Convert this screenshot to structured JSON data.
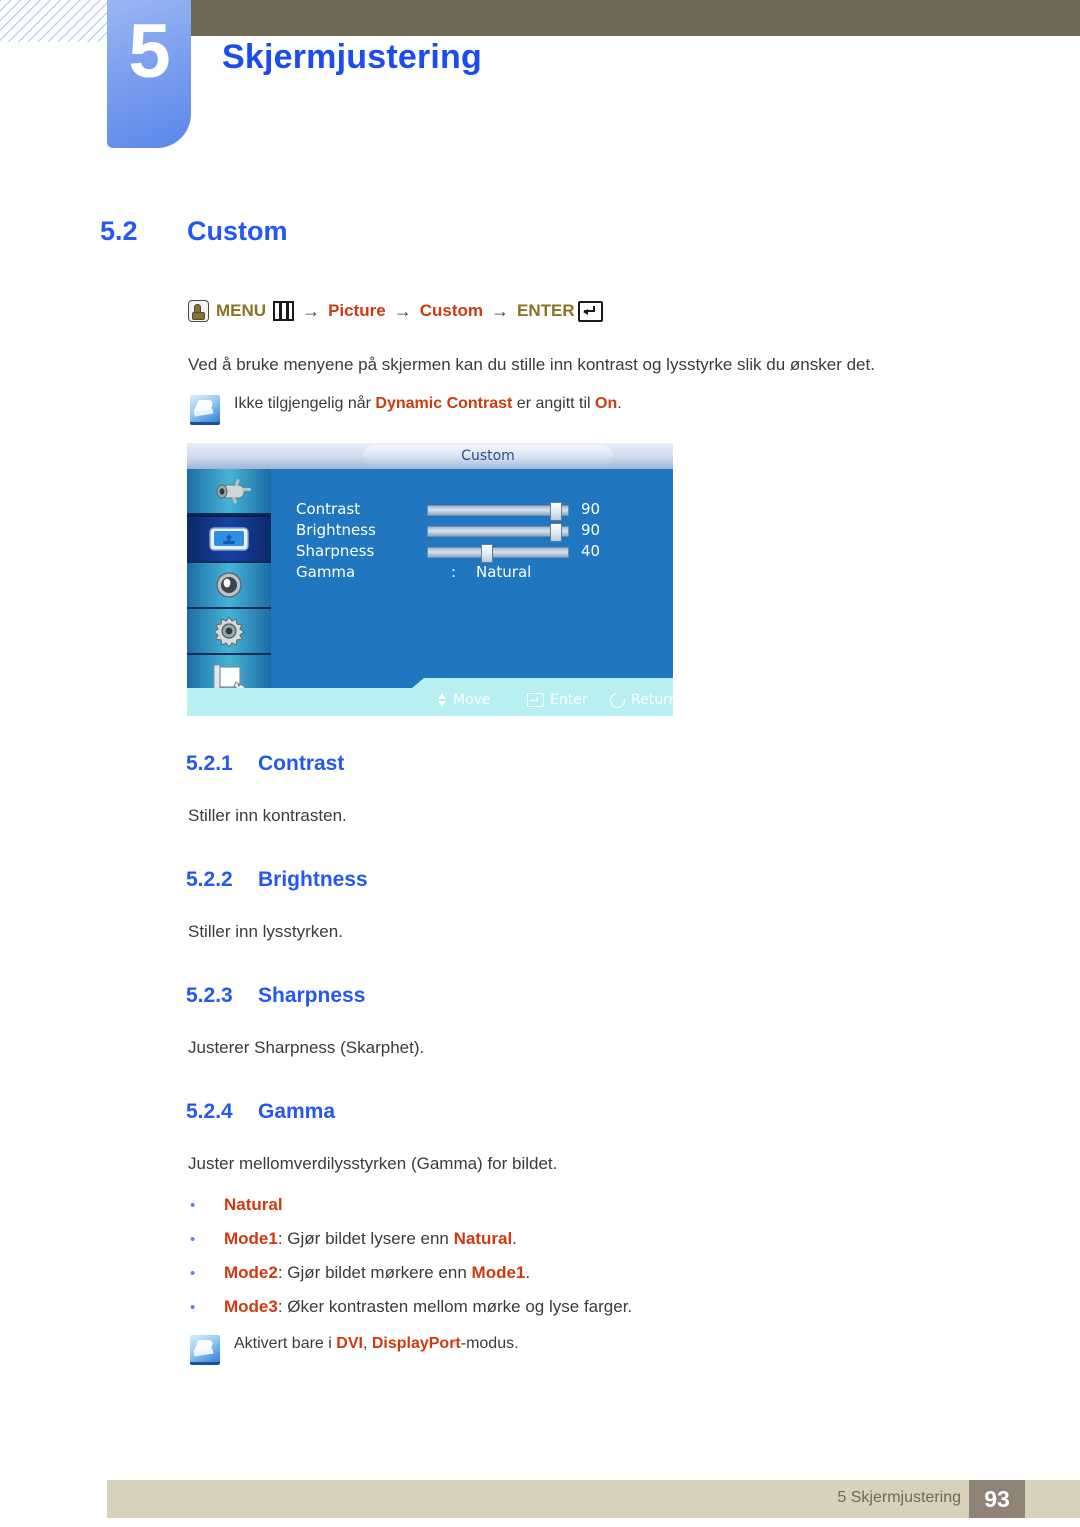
{
  "chapter": {
    "number": "5",
    "title": "Skjermjustering"
  },
  "section": {
    "number": "5.2",
    "title": "Custom"
  },
  "menu_path": {
    "hand_icon": "hand-press-icon",
    "menu_label": "MENU",
    "menu_bars_icon": "menu-bars-icon",
    "arrow1": "→",
    "item1": "Picture",
    "arrow2": "→",
    "item2": "Custom",
    "arrow3": "→",
    "enter_label": "ENTER",
    "enter_icon": "enter-key-icon"
  },
  "intro_text": "Ved å bruke menyene på skjermen kan du stille inn kontrast og lysstyrke slik du ønsker det.",
  "notes": [
    {
      "icon": "note-pencil-icon",
      "pre": "Ikke tilgjengelig når ",
      "em1": "Dynamic Contrast",
      "mid": " er angitt til ",
      "em2": "On",
      "post": "."
    },
    {
      "icon": "note-pencil-icon",
      "pre": "Aktivert bare i ",
      "em1": "DVI",
      "mid": ", ",
      "em2": "DisplayPort",
      "post": "-modus."
    }
  ],
  "osd": {
    "title": "Custom",
    "sidebar_icons": [
      "input-source-icon",
      "picture-icon",
      "sound-icon",
      "setup-gear-icon",
      "information-icon"
    ],
    "selected_sidebar_index": 1,
    "rows": [
      {
        "label": "Contrast",
        "value": "90",
        "percent": 90,
        "type": "slider"
      },
      {
        "label": "Brightness",
        "value": "90",
        "percent": 90,
        "type": "slider"
      },
      {
        "label": "Sharpness",
        "value": "40",
        "percent": 40,
        "type": "slider"
      },
      {
        "label": "Gamma",
        "value": "Natural",
        "separator": ":",
        "type": "option"
      }
    ],
    "hints": [
      {
        "icon": "move-updown-icon",
        "label": "Move"
      },
      {
        "icon": "enter-key-icon",
        "label": "Enter"
      },
      {
        "icon": "return-arrow-icon",
        "label": "Return"
      }
    ]
  },
  "subsections": [
    {
      "number": "5.2.1",
      "title": "Contrast",
      "body": "Stiller inn kontrasten."
    },
    {
      "number": "5.2.2",
      "title": "Brightness",
      "body": "Stiller inn lysstyrken."
    },
    {
      "number": "5.2.3",
      "title": "Sharpness",
      "body": "Justerer Sharpness (Skarphet)."
    },
    {
      "number": "5.2.4",
      "title": "Gamma",
      "body": "Juster mellomverdilysstyrken (Gamma) for bildet."
    }
  ],
  "gamma_options": [
    {
      "bullet": "•",
      "name": "Natural",
      "rest": ""
    },
    {
      "bullet": "•",
      "name": "Mode1",
      "sep": ": ",
      "pre": "Gjør bildet lysere enn ",
      "em": "Natural",
      "post": "."
    },
    {
      "bullet": "•",
      "name": "Mode2",
      "sep": ": ",
      "pre": "Gjør bildet mørkere enn ",
      "em": "Mode1",
      "post": "."
    },
    {
      "bullet": "•",
      "name": "Mode3",
      "sep": ": ",
      "pre": "Øker kontrasten mellom mørke og lyse farger.",
      "em": "",
      "post": ""
    }
  ],
  "footer": {
    "chapter_ref": "5 Skjermjustering",
    "page_number": "93"
  },
  "colors": {
    "heading_blue": "#2458f0",
    "accent_red": "#cf3a10",
    "gold": "#8a7321",
    "olive": "#6e6a55",
    "tab_blue": "#5b87ec",
    "footer_bg": "#d8d2bd",
    "footer_page_bg": "#8e8375",
    "osd_blue": "#2077c0"
  }
}
